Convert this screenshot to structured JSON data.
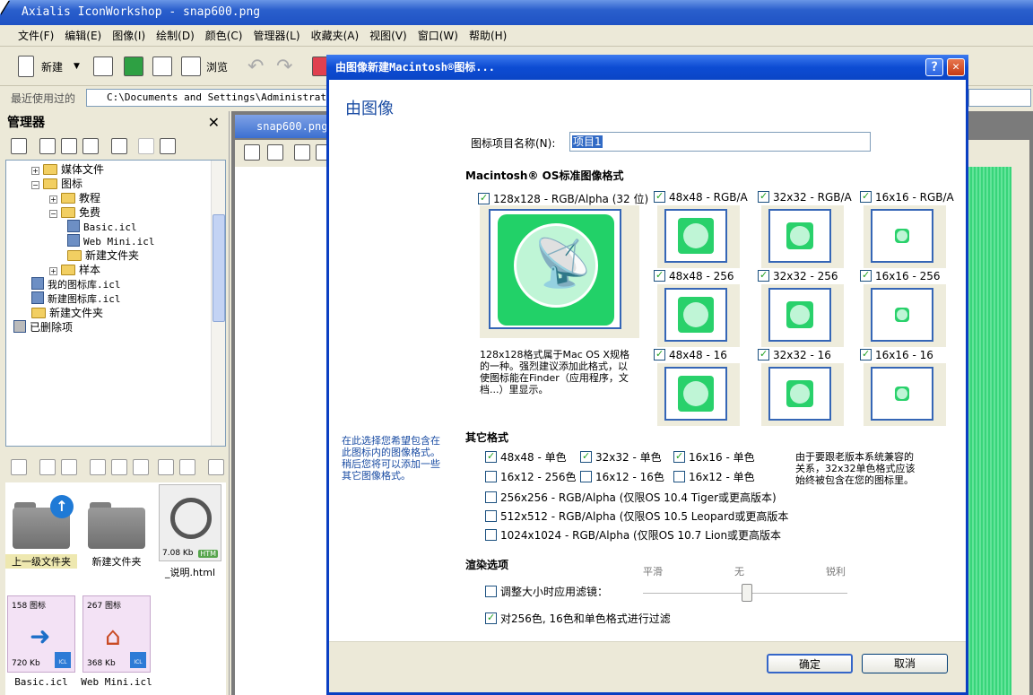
{
  "app": {
    "title": "Axialis IconWorkshop - snap600.png",
    "menu": [
      "文件(F)",
      "编辑(E)",
      "图像(I)",
      "绘制(D)",
      "颜色(C)",
      "管理器(L)",
      "收藏夹(A)",
      "视图(V)",
      "窗口(W)",
      "帮助(H)"
    ],
    "toolbar": {
      "new_label": "新建",
      "browse_label": "浏览"
    },
    "recent_label": "最近使用过的",
    "recent_path": "C:\\Documents and Settings\\Administrator\\桌"
  },
  "manager": {
    "title": "管理器",
    "close": "✕",
    "tree": [
      {
        "label": "媒体文件",
        "level": 1,
        "type": "folder",
        "toggle": "+"
      },
      {
        "label": "图标",
        "level": 1,
        "type": "folder",
        "toggle": "-"
      },
      {
        "label": "教程",
        "level": 2,
        "type": "folder",
        "toggle": "+"
      },
      {
        "label": "免费",
        "level": 2,
        "type": "folder",
        "toggle": "-"
      },
      {
        "label": "Basic.icl",
        "level": 3,
        "type": "lib"
      },
      {
        "label": "Web Mini.icl",
        "level": 3,
        "type": "lib"
      },
      {
        "label": "新建文件夹",
        "level": 3,
        "type": "folder"
      },
      {
        "label": "样本",
        "level": 2,
        "type": "folder",
        "toggle": "+"
      },
      {
        "label": "我的图标库.icl",
        "level": 1,
        "type": "lib"
      },
      {
        "label": "新建图标库.icl",
        "level": 1,
        "type": "lib"
      },
      {
        "label": "新建文件夹",
        "level": 1,
        "type": "folder"
      },
      {
        "label": "已删除项",
        "level": 0,
        "type": "trash"
      }
    ],
    "files": [
      {
        "label": "上一级文件夹",
        "kind": "folder-up",
        "selected": true
      },
      {
        "label": "新建文件夹",
        "kind": "folder"
      },
      {
        "label": "_说明.html",
        "kind": "html",
        "size": "7.08 Kb",
        "badge": "HTM"
      },
      {
        "label": "Basic.icl",
        "kind": "icl",
        "count": "158 图标",
        "size": "720 Kb",
        "badge": "ICL"
      },
      {
        "label": "Web Mini.icl",
        "kind": "icl",
        "count": "267 图标",
        "size": "368 Kb",
        "badge": "ICL"
      }
    ]
  },
  "document": {
    "tab": "snap600.png"
  },
  "dialog": {
    "title": "由图像新建Macintosh®图标...",
    "help": "?",
    "close": "✕",
    "heading": "由图像",
    "name_label": "图标项目名称(N):",
    "name_value": "项目1",
    "mac_section": "Macintosh® OS标准图像格式",
    "big_format": {
      "label": "128x128 - RGB/Alpha (32 位)",
      "checked": true
    },
    "big_desc": "128x128格式属于Mac OS X规格的一种。强烈建议添加此格式，以使图标能在Finder（应用程序，文档...）里显示。",
    "grid_formats": [
      [
        {
          "label": "48x48 - RGB/A",
          "checked": true
        },
        {
          "label": "32x32 - RGB/A",
          "checked": true
        },
        {
          "label": "16x16 - RGB/A",
          "checked": true
        }
      ],
      [
        {
          "label": "48x48 - 256",
          "checked": true
        },
        {
          "label": "32x32 - 256",
          "checked": true
        },
        {
          "label": "16x16 - 256",
          "checked": true
        }
      ],
      [
        {
          "label": "48x48 - 16",
          "checked": true
        },
        {
          "label": "32x32 - 16",
          "checked": true
        },
        {
          "label": "16x16 - 16",
          "checked": true
        }
      ]
    ],
    "left_note": "在此选择您希望包含在此图标内的图像格式。稍后您将可以添加一些其它图像格式。",
    "other_section": "其它格式",
    "other_row1": [
      {
        "label": "48x48 - 单色",
        "checked": true
      },
      {
        "label": "32x32 - 单色",
        "checked": true
      },
      {
        "label": "16x16 - 单色",
        "checked": true
      }
    ],
    "other_row2": [
      {
        "label": "16x12 - 256色",
        "checked": false
      },
      {
        "label": "16x12 - 16色",
        "checked": false
      },
      {
        "label": "16x12 - 单色",
        "checked": false
      }
    ],
    "other_long": [
      {
        "label": "256x256 - RGB/Alpha (仅限OS 10.4 Tiger或更高版本)",
        "checked": false
      },
      {
        "label": "512x512 - RGB/Alpha (仅限OS 10.5 Leopard或更高版本",
        "checked": false
      },
      {
        "label": "1024x1024 - RGB/Alpha (仅限OS 10.7 Lion或更高版本",
        "checked": false
      }
    ],
    "compat_note": "由于要跟老版本系统兼容的关系，32x32单色格式应该始终被包含在您的图标里。",
    "render_section": "渲染选项",
    "resize_filter": {
      "label": "调整大小时应用滤镜：",
      "checked": false
    },
    "slider_labels": [
      "平滑",
      "无",
      "锐利"
    ],
    "slider_value": "无",
    "filter_opt": {
      "label": "对256色, 16色和单色格式进行过滤",
      "checked": true
    },
    "ok": "确定",
    "cancel": "取消"
  },
  "colors": {
    "accent": "#0a45c6",
    "icon_green": "#22d168"
  }
}
